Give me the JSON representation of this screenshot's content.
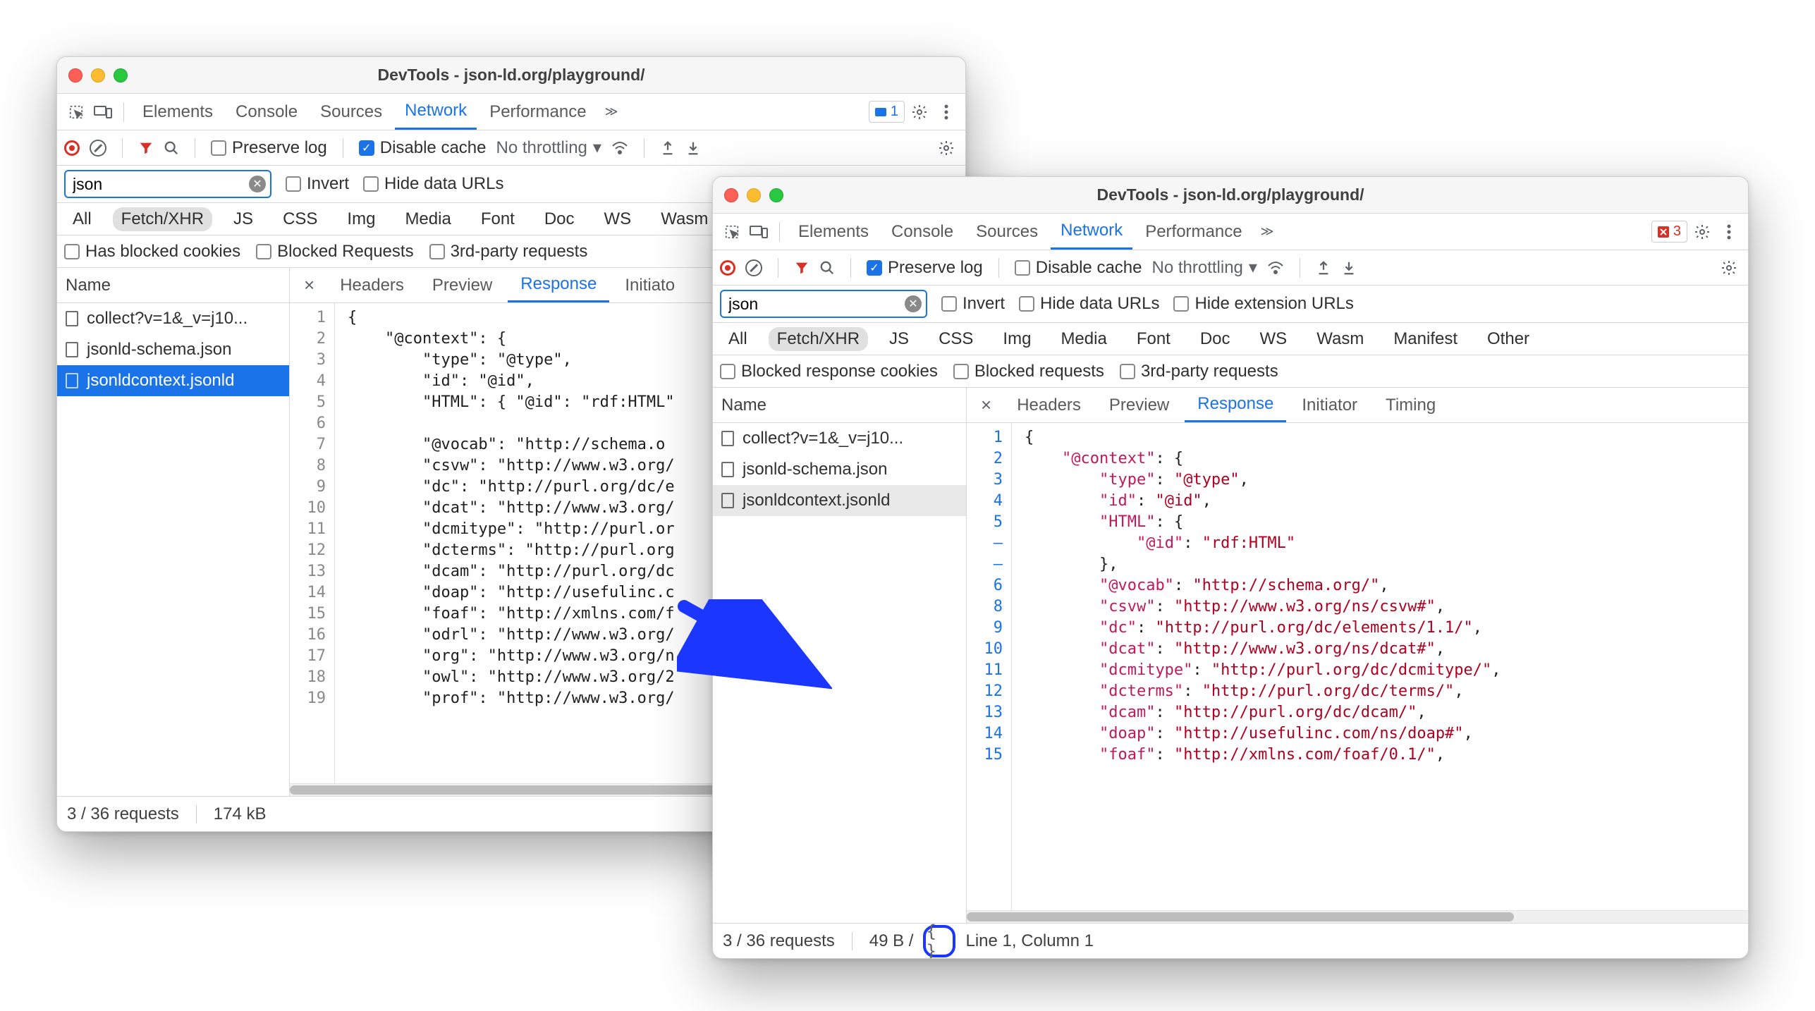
{
  "title": "DevTools - json-ld.org/playground/",
  "tabs": [
    "Elements",
    "Console",
    "Sources",
    "Network",
    "Performance"
  ],
  "active_tab": "Network",
  "badges": {
    "left_count": "1",
    "right_count": "3"
  },
  "toolbar1": {
    "preserve_log": "Preserve log",
    "disable_cache": "Disable cache",
    "throttling": "No throttling"
  },
  "filter": {
    "value": "json",
    "invert": "Invert",
    "hide_data_urls": "Hide data URLs",
    "hide_ext_urls": "Hide extension URLs"
  },
  "types": [
    "All",
    "Fetch/XHR",
    "JS",
    "CSS",
    "Img",
    "Media",
    "Font",
    "Doc",
    "WS",
    "Wasm",
    "Manifest",
    "Other"
  ],
  "selected_type": "Fetch/XHR",
  "cookies1": {
    "blocked_cookies": "Has blocked cookies",
    "blocked_requests": "Blocked Requests",
    "third_party": "3rd-party requests"
  },
  "cookies2": {
    "blocked_resp_cookies": "Blocked response cookies",
    "blocked_requests": "Blocked requests",
    "third_party": "3rd-party requests"
  },
  "name_header": "Name",
  "requests": [
    "collect?v=1&_v=j10...",
    "jsonld-schema.json",
    "jsonldcontext.jsonld"
  ],
  "requests2": [
    "collect?v=1&_v=j10...",
    "jsonld-schema.json",
    "jsonldcontext.jsonld"
  ],
  "detail_tabs": [
    "Headers",
    "Preview",
    "Response",
    "Initiator",
    "Timing"
  ],
  "detail_active": "Response",
  "detail_tabs_win1": [
    "Headers",
    "Preview",
    "Response",
    "Initiato"
  ],
  "code1": {
    "numbers": [
      "1",
      "2",
      "3",
      "4",
      "5",
      "6",
      "7",
      "8",
      "9",
      "10",
      "11",
      "12",
      "13",
      "14",
      "15",
      "16",
      "17",
      "18",
      "19"
    ],
    "lines": [
      "{",
      "    \"@context\": {",
      "        \"type\": \"@type\",",
      "        \"id\": \"@id\",",
      "        \"HTML\": { \"@id\": \"rdf:HTML\"",
      "",
      "        \"@vocab\": \"http://schema.o",
      "        \"csvw\": \"http://www.w3.org/",
      "        \"dc\": \"http://purl.org/dc/e",
      "        \"dcat\": \"http://www.w3.org/",
      "        \"dcmitype\": \"http://purl.or",
      "        \"dcterms\": \"http://purl.org",
      "        \"dcam\": \"http://purl.org/dc",
      "        \"doap\": \"http://usefulinc.c",
      "        \"foaf\": \"http://xmlns.com/f",
      "        \"odrl\": \"http://www.w3.org/",
      "        \"org\": \"http://www.w3.org/n",
      "        \"owl\": \"http://www.w3.org/2",
      "        \"prof\": \"http://www.w3.org/"
    ]
  },
  "code2": {
    "numbers": [
      "1",
      "2",
      "3",
      "4",
      "5",
      "–",
      "–",
      "6",
      "8",
      "9",
      "10",
      "11",
      "12",
      "13",
      "14",
      "15"
    ],
    "lines": [
      {
        "indent": 0,
        "tokens": [
          {
            "t": "{",
            "c": "jp"
          }
        ]
      },
      {
        "indent": 1,
        "tokens": [
          {
            "t": "\"@context\"",
            "c": "jk"
          },
          {
            "t": ": {",
            "c": "jp"
          }
        ]
      },
      {
        "indent": 2,
        "tokens": [
          {
            "t": "\"type\"",
            "c": "jk"
          },
          {
            "t": ": ",
            "c": "jp"
          },
          {
            "t": "\"@type\"",
            "c": "jr"
          },
          {
            "t": ",",
            "c": "jp"
          }
        ]
      },
      {
        "indent": 2,
        "tokens": [
          {
            "t": "\"id\"",
            "c": "jk"
          },
          {
            "t": ": ",
            "c": "jp"
          },
          {
            "t": "\"@id\"",
            "c": "jr"
          },
          {
            "t": ",",
            "c": "jp"
          }
        ]
      },
      {
        "indent": 2,
        "tokens": [
          {
            "t": "\"HTML\"",
            "c": "jk"
          },
          {
            "t": ": {",
            "c": "jp"
          }
        ]
      },
      {
        "indent": 3,
        "tokens": [
          {
            "t": "\"@id\"",
            "c": "jk"
          },
          {
            "t": ": ",
            "c": "jp"
          },
          {
            "t": "\"rdf:HTML\"",
            "c": "jr"
          }
        ]
      },
      {
        "indent": 2,
        "tokens": [
          {
            "t": "},",
            "c": "jp"
          }
        ]
      },
      {
        "indent": 2,
        "tokens": [
          {
            "t": "\"@vocab\"",
            "c": "jk"
          },
          {
            "t": ": ",
            "c": "jp"
          },
          {
            "t": "\"http://schema.org/\"",
            "c": "jr"
          },
          {
            "t": ",",
            "c": "jp"
          }
        ]
      },
      {
        "indent": 2,
        "tokens": [
          {
            "t": "\"csvw\"",
            "c": "jk"
          },
          {
            "t": ": ",
            "c": "jp"
          },
          {
            "t": "\"http://www.w3.org/ns/csvw#\"",
            "c": "jr"
          },
          {
            "t": ",",
            "c": "jp"
          }
        ]
      },
      {
        "indent": 2,
        "tokens": [
          {
            "t": "\"dc\"",
            "c": "jk"
          },
          {
            "t": ": ",
            "c": "jp"
          },
          {
            "t": "\"http://purl.org/dc/elements/1.1/\"",
            "c": "jr"
          },
          {
            "t": ",",
            "c": "jp"
          }
        ]
      },
      {
        "indent": 2,
        "tokens": [
          {
            "t": "\"dcat\"",
            "c": "jk"
          },
          {
            "t": ": ",
            "c": "jp"
          },
          {
            "t": "\"http://www.w3.org/ns/dcat#\"",
            "c": "jr"
          },
          {
            "t": ",",
            "c": "jp"
          }
        ]
      },
      {
        "indent": 2,
        "tokens": [
          {
            "t": "\"dcmitype\"",
            "c": "jk"
          },
          {
            "t": ": ",
            "c": "jp"
          },
          {
            "t": "\"http://purl.org/dc/dcmitype/\"",
            "c": "jr"
          },
          {
            "t": ",",
            "c": "jp"
          }
        ]
      },
      {
        "indent": 2,
        "tokens": [
          {
            "t": "\"dcterms\"",
            "c": "jk"
          },
          {
            "t": ": ",
            "c": "jp"
          },
          {
            "t": "\"http://purl.org/dc/terms/\"",
            "c": "jr"
          },
          {
            "t": ",",
            "c": "jp"
          }
        ]
      },
      {
        "indent": 2,
        "tokens": [
          {
            "t": "\"dcam\"",
            "c": "jk"
          },
          {
            "t": ": ",
            "c": "jp"
          },
          {
            "t": "\"http://purl.org/dc/dcam/\"",
            "c": "jr"
          },
          {
            "t": ",",
            "c": "jp"
          }
        ]
      },
      {
        "indent": 2,
        "tokens": [
          {
            "t": "\"doap\"",
            "c": "jk"
          },
          {
            "t": ": ",
            "c": "jp"
          },
          {
            "t": "\"http://usefulinc.com/ns/doap#\"",
            "c": "jr"
          },
          {
            "t": ",",
            "c": "jp"
          }
        ]
      },
      {
        "indent": 2,
        "tokens": [
          {
            "t": "\"foaf\"",
            "c": "jk"
          },
          {
            "t": ": ",
            "c": "jp"
          },
          {
            "t": "\"http://xmlns.com/foaf/0.1/\"",
            "c": "jr"
          },
          {
            "t": ",",
            "c": "jp"
          }
        ]
      }
    ]
  },
  "footer1": {
    "requests": "3 / 36 requests",
    "size": "174 kB"
  },
  "footer2": {
    "requests": "3 / 36 requests",
    "size": "49 B /",
    "cursor": "Line 1, Column 1"
  }
}
